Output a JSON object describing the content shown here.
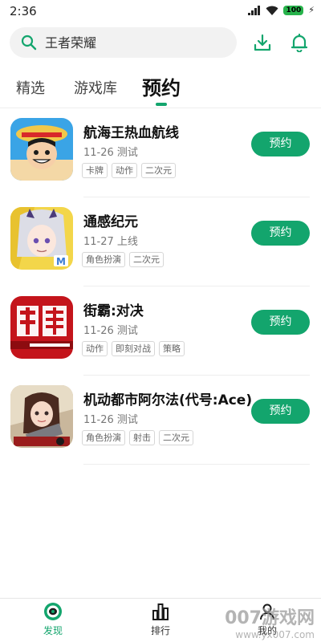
{
  "status_bar": {
    "time": "2:36",
    "battery": "100"
  },
  "search": {
    "placeholder": "王者荣耀"
  },
  "header": {
    "icons": [
      "download-icon",
      "bell-icon"
    ]
  },
  "tabs": [
    {
      "label": "精选",
      "active": false
    },
    {
      "label": "游戏库",
      "active": false
    },
    {
      "label": "预约",
      "active": true
    }
  ],
  "games": [
    {
      "name": "航海王热血航线",
      "date": "11-26 测试",
      "tags": [
        "卡牌",
        "动作",
        "二次元"
      ],
      "button": "预约"
    },
    {
      "name": "通感纪元",
      "date": "11-27 上线",
      "tags": [
        "角色扮演",
        "二次元"
      ],
      "button": "预约"
    },
    {
      "name": "街霸:对决",
      "date": "11-26 测试",
      "tags": [
        "动作",
        "即刻对战",
        "策略"
      ],
      "button": "预约"
    },
    {
      "name": "机动都市阿尔法(代号:Ace)",
      "date": "11-26 测试",
      "tags": [
        "角色扮演",
        "射击",
        "二次元"
      ],
      "button": "预约"
    }
  ],
  "bottom_nav": [
    {
      "label": "发现",
      "active": true
    },
    {
      "label": "排行",
      "active": false
    },
    {
      "label": "我的",
      "active": false
    }
  ],
  "watermark": {
    "text": "007游戏网",
    "url": "www.yx007.com"
  },
  "colors": {
    "accent": "#13a56d",
    "battery": "#27b34b"
  }
}
